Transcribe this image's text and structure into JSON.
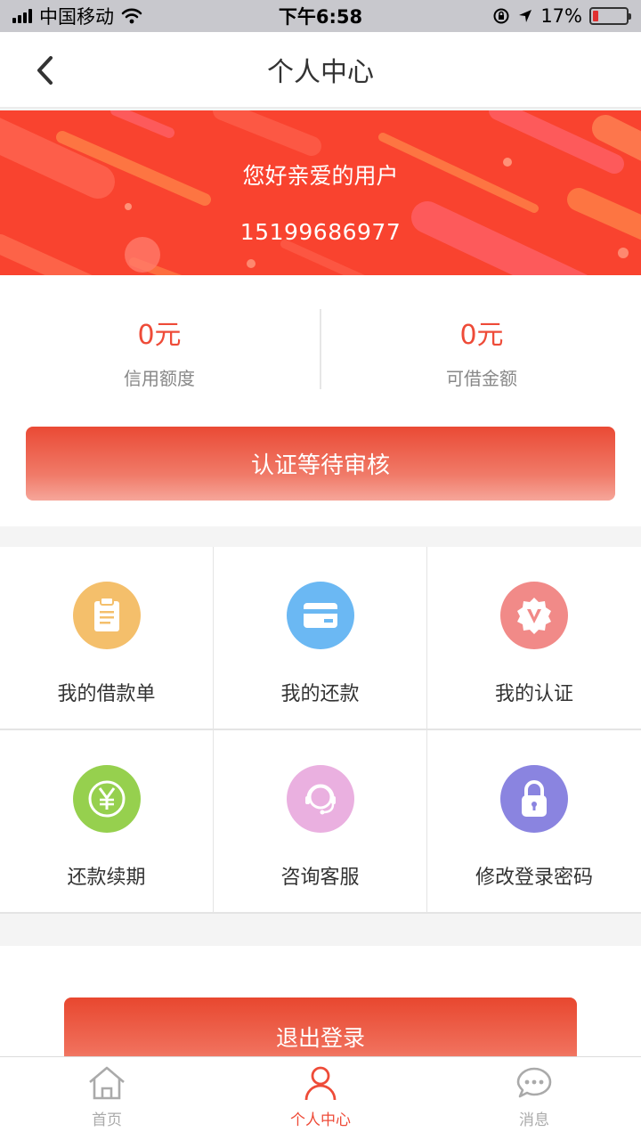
{
  "status_bar": {
    "carrier": "中国移动",
    "time": "下午6:58",
    "battery": "17%",
    "battery_level_percent": 17
  },
  "nav": {
    "title": "个人中心",
    "back_icon": "chevron-left-icon"
  },
  "banner": {
    "greeting": "您好亲爱的用户",
    "phone": "15199686977"
  },
  "stats": {
    "credit_value": "0元",
    "credit_label": "信用额度",
    "borrowable_value": "0元",
    "borrowable_label": "可借金额"
  },
  "status_button": {
    "label": "认证等待审核"
  },
  "grid": {
    "items": [
      {
        "label": "我的借款单",
        "icon": "clipboard-icon",
        "color": "#f4bf6b"
      },
      {
        "label": "我的还款",
        "icon": "card-icon",
        "color": "#6bb8f3"
      },
      {
        "label": "我的认证",
        "icon": "verified-badge-icon",
        "color": "#f18a88"
      },
      {
        "label": "还款续期",
        "icon": "yuan-icon",
        "color": "#96d04e"
      },
      {
        "label": "咨询客服",
        "icon": "headset-icon",
        "color": "#eab0e0"
      },
      {
        "label": "修改登录密码",
        "icon": "lock-icon",
        "color": "#8a84e0"
      }
    ]
  },
  "logout": {
    "label": "退出登录"
  },
  "tab_bar": {
    "tabs": [
      {
        "label": "首页",
        "icon": "home-icon",
        "active": false
      },
      {
        "label": "个人中心",
        "icon": "user-icon",
        "active": true
      },
      {
        "label": "消息",
        "icon": "chat-icon",
        "active": false
      }
    ]
  },
  "colors": {
    "accent": "#ee4b38",
    "banner": "#f9432f"
  }
}
